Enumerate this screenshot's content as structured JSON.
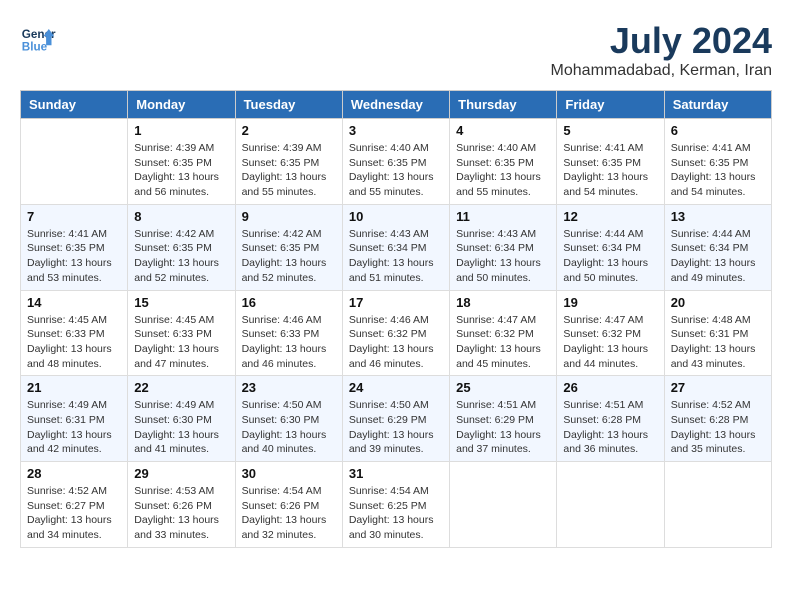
{
  "header": {
    "logo_line1": "General",
    "logo_line2": "Blue",
    "month_year": "July 2024",
    "location": "Mohammadabad, Kerman, Iran"
  },
  "weekdays": [
    "Sunday",
    "Monday",
    "Tuesday",
    "Wednesday",
    "Thursday",
    "Friday",
    "Saturday"
  ],
  "weeks": [
    [
      {
        "day": "",
        "sunrise": "",
        "sunset": "",
        "daylight": ""
      },
      {
        "day": "1",
        "sunrise": "4:39 AM",
        "sunset": "6:35 PM",
        "daylight": "13 hours and 56 minutes."
      },
      {
        "day": "2",
        "sunrise": "4:39 AM",
        "sunset": "6:35 PM",
        "daylight": "13 hours and 55 minutes."
      },
      {
        "day": "3",
        "sunrise": "4:40 AM",
        "sunset": "6:35 PM",
        "daylight": "13 hours and 55 minutes."
      },
      {
        "day": "4",
        "sunrise": "4:40 AM",
        "sunset": "6:35 PM",
        "daylight": "13 hours and 55 minutes."
      },
      {
        "day": "5",
        "sunrise": "4:41 AM",
        "sunset": "6:35 PM",
        "daylight": "13 hours and 54 minutes."
      },
      {
        "day": "6",
        "sunrise": "4:41 AM",
        "sunset": "6:35 PM",
        "daylight": "13 hours and 54 minutes."
      }
    ],
    [
      {
        "day": "7",
        "sunrise": "4:41 AM",
        "sunset": "6:35 PM",
        "daylight": "13 hours and 53 minutes."
      },
      {
        "day": "8",
        "sunrise": "4:42 AM",
        "sunset": "6:35 PM",
        "daylight": "13 hours and 52 minutes."
      },
      {
        "day": "9",
        "sunrise": "4:42 AM",
        "sunset": "6:35 PM",
        "daylight": "13 hours and 52 minutes."
      },
      {
        "day": "10",
        "sunrise": "4:43 AM",
        "sunset": "6:34 PM",
        "daylight": "13 hours and 51 minutes."
      },
      {
        "day": "11",
        "sunrise": "4:43 AM",
        "sunset": "6:34 PM",
        "daylight": "13 hours and 50 minutes."
      },
      {
        "day": "12",
        "sunrise": "4:44 AM",
        "sunset": "6:34 PM",
        "daylight": "13 hours and 50 minutes."
      },
      {
        "day": "13",
        "sunrise": "4:44 AM",
        "sunset": "6:34 PM",
        "daylight": "13 hours and 49 minutes."
      }
    ],
    [
      {
        "day": "14",
        "sunrise": "4:45 AM",
        "sunset": "6:33 PM",
        "daylight": "13 hours and 48 minutes."
      },
      {
        "day": "15",
        "sunrise": "4:45 AM",
        "sunset": "6:33 PM",
        "daylight": "13 hours and 47 minutes."
      },
      {
        "day": "16",
        "sunrise": "4:46 AM",
        "sunset": "6:33 PM",
        "daylight": "13 hours and 46 minutes."
      },
      {
        "day": "17",
        "sunrise": "4:46 AM",
        "sunset": "6:32 PM",
        "daylight": "13 hours and 46 minutes."
      },
      {
        "day": "18",
        "sunrise": "4:47 AM",
        "sunset": "6:32 PM",
        "daylight": "13 hours and 45 minutes."
      },
      {
        "day": "19",
        "sunrise": "4:47 AM",
        "sunset": "6:32 PM",
        "daylight": "13 hours and 44 minutes."
      },
      {
        "day": "20",
        "sunrise": "4:48 AM",
        "sunset": "6:31 PM",
        "daylight": "13 hours and 43 minutes."
      }
    ],
    [
      {
        "day": "21",
        "sunrise": "4:49 AM",
        "sunset": "6:31 PM",
        "daylight": "13 hours and 42 minutes."
      },
      {
        "day": "22",
        "sunrise": "4:49 AM",
        "sunset": "6:30 PM",
        "daylight": "13 hours and 41 minutes."
      },
      {
        "day": "23",
        "sunrise": "4:50 AM",
        "sunset": "6:30 PM",
        "daylight": "13 hours and 40 minutes."
      },
      {
        "day": "24",
        "sunrise": "4:50 AM",
        "sunset": "6:29 PM",
        "daylight": "13 hours and 39 minutes."
      },
      {
        "day": "25",
        "sunrise": "4:51 AM",
        "sunset": "6:29 PM",
        "daylight": "13 hours and 37 minutes."
      },
      {
        "day": "26",
        "sunrise": "4:51 AM",
        "sunset": "6:28 PM",
        "daylight": "13 hours and 36 minutes."
      },
      {
        "day": "27",
        "sunrise": "4:52 AM",
        "sunset": "6:28 PM",
        "daylight": "13 hours and 35 minutes."
      }
    ],
    [
      {
        "day": "28",
        "sunrise": "4:52 AM",
        "sunset": "6:27 PM",
        "daylight": "13 hours and 34 minutes."
      },
      {
        "day": "29",
        "sunrise": "4:53 AM",
        "sunset": "6:26 PM",
        "daylight": "13 hours and 33 minutes."
      },
      {
        "day": "30",
        "sunrise": "4:54 AM",
        "sunset": "6:26 PM",
        "daylight": "13 hours and 32 minutes."
      },
      {
        "day": "31",
        "sunrise": "4:54 AM",
        "sunset": "6:25 PM",
        "daylight": "13 hours and 30 minutes."
      },
      {
        "day": "",
        "sunrise": "",
        "sunset": "",
        "daylight": ""
      },
      {
        "day": "",
        "sunrise": "",
        "sunset": "",
        "daylight": ""
      },
      {
        "day": "",
        "sunrise": "",
        "sunset": "",
        "daylight": ""
      }
    ]
  ],
  "labels": {
    "sunrise": "Sunrise:",
    "sunset": "Sunset:",
    "daylight": "Daylight:"
  }
}
